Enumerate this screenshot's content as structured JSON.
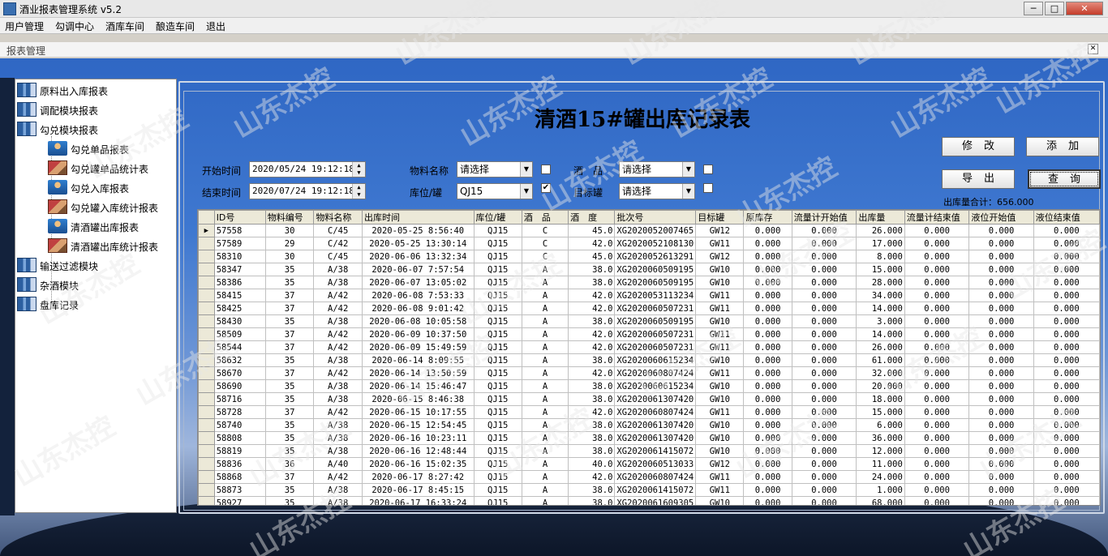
{
  "window": {
    "title": "酒业报表管理系统 v5.2",
    "min": "─",
    "max": "□",
    "close": "✕"
  },
  "menu": [
    "用户管理",
    "勾调中心",
    "酒库车间",
    "酿造车间",
    "退出"
  ],
  "child": {
    "title": "报表管理",
    "close": "✕"
  },
  "tree": [
    {
      "label": "原料出入库报表",
      "icon": "books-icon",
      "level": 0
    },
    {
      "label": "调配模块报表",
      "icon": "books-icon",
      "level": 0
    },
    {
      "label": "勾兑模块报表",
      "icon": "books-icon",
      "level": 0
    },
    {
      "label": "勾兑单品报表",
      "icon": "user-icon",
      "level": 1
    },
    {
      "label": "勾兑罐单品统计表",
      "icon": "box-icon",
      "level": 1
    },
    {
      "label": "勾兑入库报表",
      "icon": "user-icon",
      "level": 1
    },
    {
      "label": "勾兑罐入库统计报表",
      "icon": "box-icon",
      "level": 1
    },
    {
      "label": "清酒罐出库报表",
      "icon": "user-icon",
      "level": 1
    },
    {
      "label": "清酒罐出库统计报表",
      "icon": "box-icon",
      "level": 1
    },
    {
      "label": "输送过滤模块",
      "icon": "books-icon",
      "level": 0
    },
    {
      "label": "杂酒模块",
      "icon": "books-icon",
      "level": 0
    },
    {
      "label": "盘库记录",
      "icon": "books-icon",
      "level": 0
    }
  ],
  "report": {
    "title": "清酒15#罐出库记录表",
    "start_label": "开始时间",
    "start_value": "2020/05/24 19:12:18",
    "end_label": "结束时间",
    "end_value": "2020/07/24 19:12:18",
    "material_label": "物料名称",
    "material_value": "请选择",
    "wine_label": "酒　品",
    "wine_value": "请选择",
    "location_label": "库位/罐",
    "location_value": "QJ15",
    "target_label": "目标罐",
    "target_value": "请选择",
    "location_checked": "✔",
    "btn_edit": "修改",
    "btn_add": "添加",
    "btn_export": "导出",
    "btn_query": "查询",
    "total": "出库量合计：656.000"
  },
  "grid": {
    "columns": [
      "ID号",
      "物料编号",
      "物料名称",
      "出库时间",
      "库位/罐",
      "酒　品",
      "酒　度",
      "批次号",
      "目标罐",
      "原库存",
      "流量计开始值",
      "出库量",
      "流量计结束值",
      "液位开始值",
      "液位结束值"
    ],
    "rows": [
      [
        "57558",
        "30",
        "C/45",
        "2020-05-25 8:56:40",
        "QJ15",
        "C",
        "45.0",
        "XG2020052007465",
        "GW12",
        "0.000",
        "0.000",
        "26.000",
        "0.000",
        "0.000",
        "0.000"
      ],
      [
        "57589",
        "29",
        "C/42",
        "2020-05-25 13:30:14",
        "QJ15",
        "C",
        "42.0",
        "XG2020052108130",
        "GW11",
        "0.000",
        "0.000",
        "17.000",
        "0.000",
        "0.000",
        "0.000"
      ],
      [
        "58310",
        "30",
        "C/45",
        "2020-06-06 13:32:34",
        "QJ15",
        "C",
        "45.0",
        "XG2020052613291",
        "GW12",
        "0.000",
        "0.000",
        "8.000",
        "0.000",
        "0.000",
        "0.000"
      ],
      [
        "58347",
        "35",
        "A/38",
        "2020-06-07 7:57:54",
        "QJ15",
        "A",
        "38.0",
        "XG2020060509195",
        "GW10",
        "0.000",
        "0.000",
        "15.000",
        "0.000",
        "0.000",
        "0.000"
      ],
      [
        "58386",
        "35",
        "A/38",
        "2020-06-07 13:05:02",
        "QJ15",
        "A",
        "38.0",
        "XG2020060509195",
        "GW10",
        "0.000",
        "0.000",
        "28.000",
        "0.000",
        "0.000",
        "0.000"
      ],
      [
        "58415",
        "37",
        "A/42",
        "2020-06-08 7:53:33",
        "QJ15",
        "A",
        "42.0",
        "XG2020053113234",
        "GW11",
        "0.000",
        "0.000",
        "34.000",
        "0.000",
        "0.000",
        "0.000"
      ],
      [
        "58425",
        "37",
        "A/42",
        "2020-06-08 9:01:42",
        "QJ15",
        "A",
        "42.0",
        "XG2020060507231",
        "GW11",
        "0.000",
        "0.000",
        "14.000",
        "0.000",
        "0.000",
        "0.000"
      ],
      [
        "58430",
        "35",
        "A/38",
        "2020-06-08 10:05:58",
        "QJ15",
        "A",
        "38.0",
        "XG2020060509195",
        "GW10",
        "0.000",
        "0.000",
        "3.000",
        "0.000",
        "0.000",
        "0.000"
      ],
      [
        "58509",
        "37",
        "A/42",
        "2020-06-09 10:37:50",
        "QJ15",
        "A",
        "42.0",
        "XG2020060507231",
        "GW11",
        "0.000",
        "0.000",
        "14.000",
        "0.000",
        "0.000",
        "0.000"
      ],
      [
        "58544",
        "37",
        "A/42",
        "2020-06-09 15:49:59",
        "QJ15",
        "A",
        "42.0",
        "XG2020060507231",
        "GW11",
        "0.000",
        "0.000",
        "26.000",
        "0.000",
        "0.000",
        "0.000"
      ],
      [
        "58632",
        "35",
        "A/38",
        "2020-06-14 8:09:55",
        "QJ15",
        "A",
        "38.0",
        "XG2020060615234",
        "GW10",
        "0.000",
        "0.000",
        "61.000",
        "0.000",
        "0.000",
        "0.000"
      ],
      [
        "58670",
        "37",
        "A/42",
        "2020-06-14 13:50:59",
        "QJ15",
        "A",
        "42.0",
        "XG2020060807424",
        "GW11",
        "0.000",
        "0.000",
        "32.000",
        "0.000",
        "0.000",
        "0.000"
      ],
      [
        "58690",
        "35",
        "A/38",
        "2020-06-14 15:46:47",
        "QJ15",
        "A",
        "38.0",
        "XG2020060615234",
        "GW10",
        "0.000",
        "0.000",
        "20.000",
        "0.000",
        "0.000",
        "0.000"
      ],
      [
        "58716",
        "35",
        "A/38",
        "2020-06-15 8:46:38",
        "QJ15",
        "A",
        "38.0",
        "XG2020061307420",
        "GW10",
        "0.000",
        "0.000",
        "18.000",
        "0.000",
        "0.000",
        "0.000"
      ],
      [
        "58728",
        "37",
        "A/42",
        "2020-06-15 10:17:55",
        "QJ15",
        "A",
        "42.0",
        "XG2020060807424",
        "GW11",
        "0.000",
        "0.000",
        "15.000",
        "0.000",
        "0.000",
        "0.000"
      ],
      [
        "58740",
        "35",
        "A/38",
        "2020-06-15 12:54:45",
        "QJ15",
        "A",
        "38.0",
        "XG2020061307420",
        "GW10",
        "0.000",
        "0.000",
        "6.000",
        "0.000",
        "0.000",
        "0.000"
      ],
      [
        "58808",
        "35",
        "A/38",
        "2020-06-16 10:23:11",
        "QJ15",
        "A",
        "38.0",
        "XG2020061307420",
        "GW10",
        "0.000",
        "0.000",
        "36.000",
        "0.000",
        "0.000",
        "0.000"
      ],
      [
        "58819",
        "35",
        "A/38",
        "2020-06-16 12:48:44",
        "QJ15",
        "A",
        "38.0",
        "XG2020061415072",
        "GW10",
        "0.000",
        "0.000",
        "12.000",
        "0.000",
        "0.000",
        "0.000"
      ],
      [
        "58836",
        "36",
        "A/40",
        "2020-06-16 15:02:35",
        "QJ15",
        "A",
        "40.0",
        "XG2020060513033",
        "GW12",
        "0.000",
        "0.000",
        "11.000",
        "0.000",
        "0.000",
        "0.000"
      ],
      [
        "58868",
        "37",
        "A/42",
        "2020-06-17 8:27:42",
        "QJ15",
        "A",
        "42.0",
        "XG2020060807424",
        "GW11",
        "0.000",
        "0.000",
        "24.000",
        "0.000",
        "0.000",
        "0.000"
      ],
      [
        "58873",
        "35",
        "A/38",
        "2020-06-17 8:45:15",
        "QJ15",
        "A",
        "38.0",
        "XG2020061415072",
        "GW11",
        "0.000",
        "0.000",
        "1.000",
        "0.000",
        "0.000",
        "0.000"
      ],
      [
        "58927",
        "35",
        "A/38",
        "2020-06-17 16:33:24",
        "QJ15",
        "A",
        "38.0",
        "XG2020061609305",
        "GW10",
        "0.000",
        "0.000",
        "68.000",
        "0.000",
        "0.000",
        "0.000"
      ]
    ]
  },
  "watermark": "山东杰控"
}
